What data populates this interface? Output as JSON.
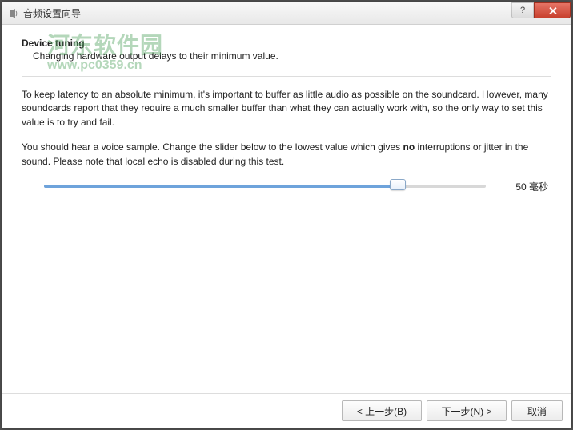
{
  "window": {
    "title": "音频设置向导"
  },
  "header": {
    "title": "Device tuning",
    "subtitle": "Changing hardware output delays to their minimum value."
  },
  "body": {
    "para1": "To keep latency to an absolute minimum, it's important to buffer as little audio as possible on the soundcard. However, many soundcards report that they require a much smaller buffer than what they can actually work with, so the only way to set this value is to try and fail.",
    "para2_a": "You should hear a voice sample. Change the slider below to the lowest value which gives ",
    "para2_bold": "no",
    "para2_b": " interruptions or jitter in the sound. Please note that local echo is disabled during this test."
  },
  "slider": {
    "percent": 80,
    "value_label": "50 毫秒"
  },
  "footer": {
    "back": "< 上一步(B)",
    "next": "下一步(N) >",
    "cancel": "取消"
  },
  "watermark": {
    "line1": "河东软件园",
    "line2": "www.pc0359.cn"
  }
}
